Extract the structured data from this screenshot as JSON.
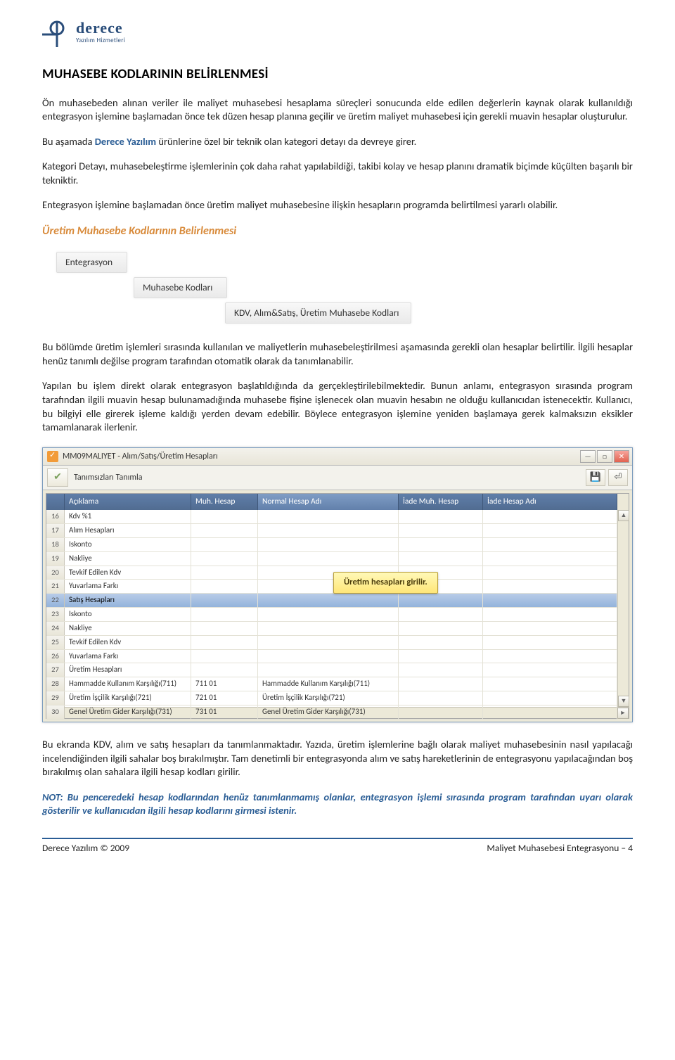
{
  "logo": {
    "brand": "derece",
    "tagline": "Yazılım Hizmetleri"
  },
  "heading": "MUHASEBE KODLARININ BELİRLENMESİ",
  "p1": "Ön muhasebeden alınan veriler ile maliyet muhasebesi hesaplama süreçleri sonucunda elde edilen değerlerin kaynak olarak kullanıldığı entegrasyon işlemine başlamadan önce tek düzen hesap planına geçilir ve üretim maliyet muhasebesi için gerekli muavin hesaplar oluşturulur.",
  "p2a": "Bu aşamada ",
  "p2brand": "Derece Yazılım",
  "p2b": " ürünlerine özel bir teknik olan kategori detayı da devreye girer.",
  "p3": "Kategori Detayı, muhasebeleştirme işlemlerinin çok daha rahat yapılabildiği, takibi kolay ve hesap planını dramatik biçimde küçülten başarılı bir tekniktir.",
  "p4": "Entegrasyon işlemine başlamadan önce üretim maliyet muhasebesine ilişkin hesapların programda belirtilmesi yararlı olabilir.",
  "section_h": "Üretim Muhasebe Kodlarının Belirlenmesi",
  "bc": {
    "b1": "Entegrasyon",
    "b2": "Muhasebe Kodları",
    "b3": "KDV, Alım&Satış, Üretim Muhasebe Kodları"
  },
  "p5": "Bu bölümde üretim işlemleri sırasında kullanılan ve maliyetlerin muhasebeleştirilmesi aşamasında gerekli olan hesaplar belirtilir. İlgili hesaplar henüz tanımlı değilse program tarafından otomatik olarak da tanımlanabilir.",
  "p6": "Yapılan bu işlem direkt olarak entegrasyon başlatıldığında da gerçekleştirilebilmektedir. Bunun anlamı, entegrasyon sırasında program tarafından ilgili muavin hesap bulunamadığında muhasebe fişine işlenecek olan muavin hesabın ne olduğu kullanıcıdan istenecektir. Kullanıcı, bu bilgiyi elle girerek işleme kaldığı yerden devam edebilir. Böylece entegrasyon işlemine yeniden başlamaya gerek kalmaksızın eksikler tamamlanarak ilerlenir.",
  "window": {
    "title": "MM09MALIYET - Alım/Satış/Üretim Hesapları",
    "toolbar_label": "Tanımsızları Tanımla",
    "headers": {
      "h1": "Açıklama",
      "h2": "Muh. Hesap",
      "h3": "Normal Hesap Adı",
      "h4": "İade Muh. Hesap",
      "h5": "İade Hesap Adı"
    },
    "rows": [
      {
        "n": "16",
        "a": "Kdv %1"
      },
      {
        "n": "17",
        "a": "Alım Hesapları"
      },
      {
        "n": "18",
        "a": "Iskonto"
      },
      {
        "n": "19",
        "a": "Nakliye"
      },
      {
        "n": "20",
        "a": "Tevkif Edilen Kdv"
      },
      {
        "n": "21",
        "a": "Yuvarlama Farkı"
      },
      {
        "n": "22",
        "a": "Satış Hesapları",
        "sel": true
      },
      {
        "n": "23",
        "a": "Iskonto"
      },
      {
        "n": "24",
        "a": "Nakliye"
      },
      {
        "n": "25",
        "a": "Tevkif Edilen Kdv"
      },
      {
        "n": "26",
        "a": "Yuvarlama Farkı"
      },
      {
        "n": "27",
        "a": "Üretim Hesapları"
      },
      {
        "n": "28",
        "a": "Hammadde Kullanım Karşılığı(711)",
        "b": "711 01",
        "c": "Hammadde Kullanım Karşılığı(711)"
      },
      {
        "n": "29",
        "a": "Üretim İşçilik Karşılığı(721)",
        "b": "721 01",
        "c": "Üretim İşçilik Karşılığı(721)"
      },
      {
        "n": "30",
        "a": "Genel Üretim Gider Karşılığı(731)",
        "b": "731 01",
        "c": "Genel Üretim Gider Karşılığı(731)"
      }
    ],
    "tooltip": "Üretim hesapları girilir."
  },
  "p7": "Bu ekranda KDV, alım ve satış hesapları da tanımlanmaktadır. Yazıda, üretim işlemlerine bağlı olarak maliyet muhasebesinin nasıl yapılacağı incelendiğinden ilgili sahalar boş bırakılmıştır. Tam denetimli bir entegrasyonda alım ve satış hareketlerinin de entegrasyonu yapılacağından boş bırakılmış olan sahalara ilgili hesap kodları girilir.",
  "note": "NOT: Bu penceredeki hesap kodlarından henüz tanımlanmamış olanlar, entegrasyon işlemi sırasında program tarafından uyarı olarak gösterilir ve kullanıcıdan ilgili hesap kodlarını girmesi istenir.",
  "footer": {
    "left": "Derece Yazılım © 2009",
    "right": "Maliyet Muhasebesi Entegrasyonu – 4"
  }
}
